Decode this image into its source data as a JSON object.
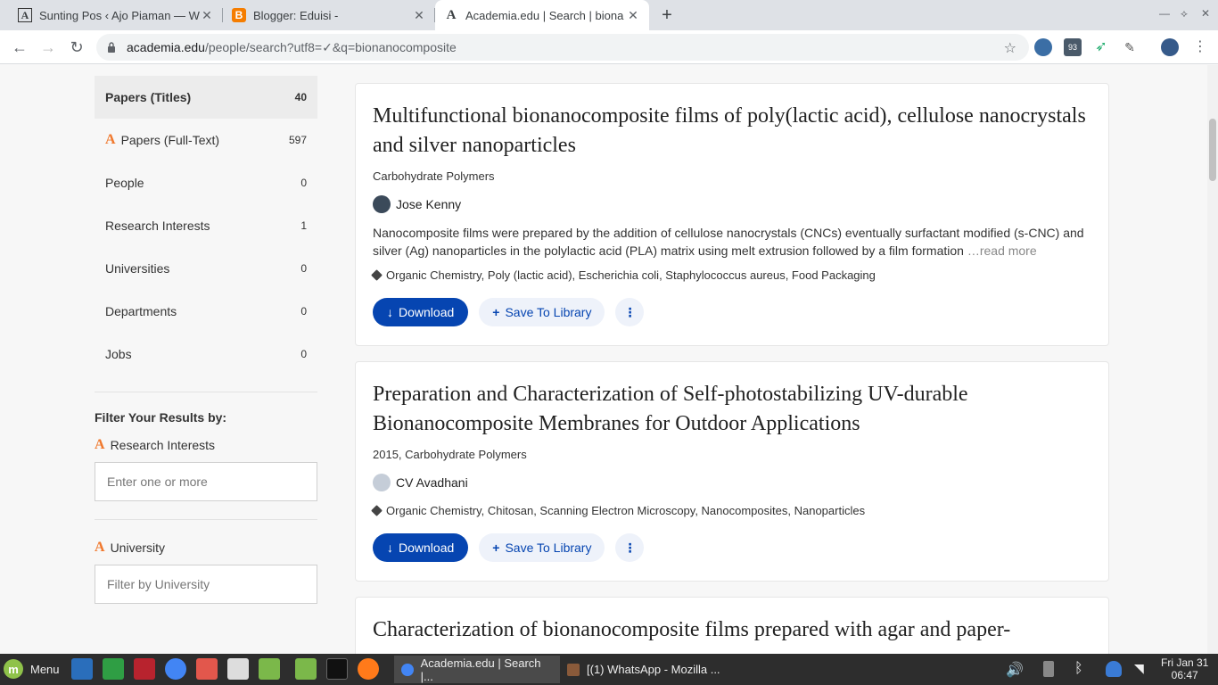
{
  "browser": {
    "tabs": [
      {
        "title": "Sunting Pos ‹ Ajo Piaman — W",
        "active": false,
        "favicon": "wordpress-icon"
      },
      {
        "title": "Blogger: Eduisi -",
        "active": false,
        "favicon": "blogger-icon"
      },
      {
        "title": "Academia.edu | Search | biona",
        "active": true,
        "favicon": "academia-icon"
      }
    ],
    "url_host": "academia.edu",
    "url_path": "/people/search?utf8=✓&q=bionanocomposite",
    "badge_count": "93"
  },
  "sidebar": {
    "items": [
      {
        "label": "Papers (Titles)",
        "count": "40"
      },
      {
        "label": "Papers (Full-Text)",
        "count": "597"
      },
      {
        "label": "People",
        "count": "0"
      },
      {
        "label": "Research Interests",
        "count": "1"
      },
      {
        "label": "Universities",
        "count": "0"
      },
      {
        "label": "Departments",
        "count": "0"
      },
      {
        "label": "Jobs",
        "count": "0"
      }
    ],
    "filter_title": "Filter Your Results by:",
    "filters": [
      {
        "label": "Research Interests",
        "placeholder": "Enter one or more"
      },
      {
        "label": "University",
        "placeholder": "Filter by University"
      }
    ]
  },
  "results": [
    {
      "title": "Multifunctional bionanocomposite films of poly(lactic acid), cellulose nanocrystals and silver nanoparticles",
      "journal": "Carbohydrate Polymers",
      "author": "Jose Kenny",
      "abstract": "Nanocomposite films were prepared by the addition of cellulose nanocrystals (CNCs) eventually surfactant modified (s-CNC) and silver (Ag) nanoparticles in the polylactic acid (PLA) matrix using melt extrusion followed by a film formation",
      "read_more": "…read more",
      "tags": "Organic Chemistry, Poly (lactic acid), Escherichia coli, Staphylococcus aureus, Food Packaging"
    },
    {
      "title": "Preparation and Characterization of Self-photostabilizing UV-durable Bionanocomposite Membranes for Outdoor Applications",
      "journal": "2015, Carbohydrate Polymers",
      "author": "CV Avadhani",
      "tags": "Organic Chemistry, Chitosan, Scanning Electron Microscopy, Nanocomposites, Nanoparticles"
    },
    {
      "title": "Characterization of bionanocomposite films prepared with agar and paper-"
    }
  ],
  "buttons": {
    "download": "Download",
    "save": "Save To Library",
    "more": "⋮"
  },
  "taskbar": {
    "menu_label": "Menu",
    "tasks": [
      {
        "title": "Academia.edu | Search |..."
      },
      {
        "title": "[(1) WhatsApp - Mozilla ..."
      }
    ],
    "date": "Fri Jan 31",
    "time": "06:47"
  },
  "colors": {
    "accent": "#0645b1",
    "brand_orange": "#f0782d"
  }
}
